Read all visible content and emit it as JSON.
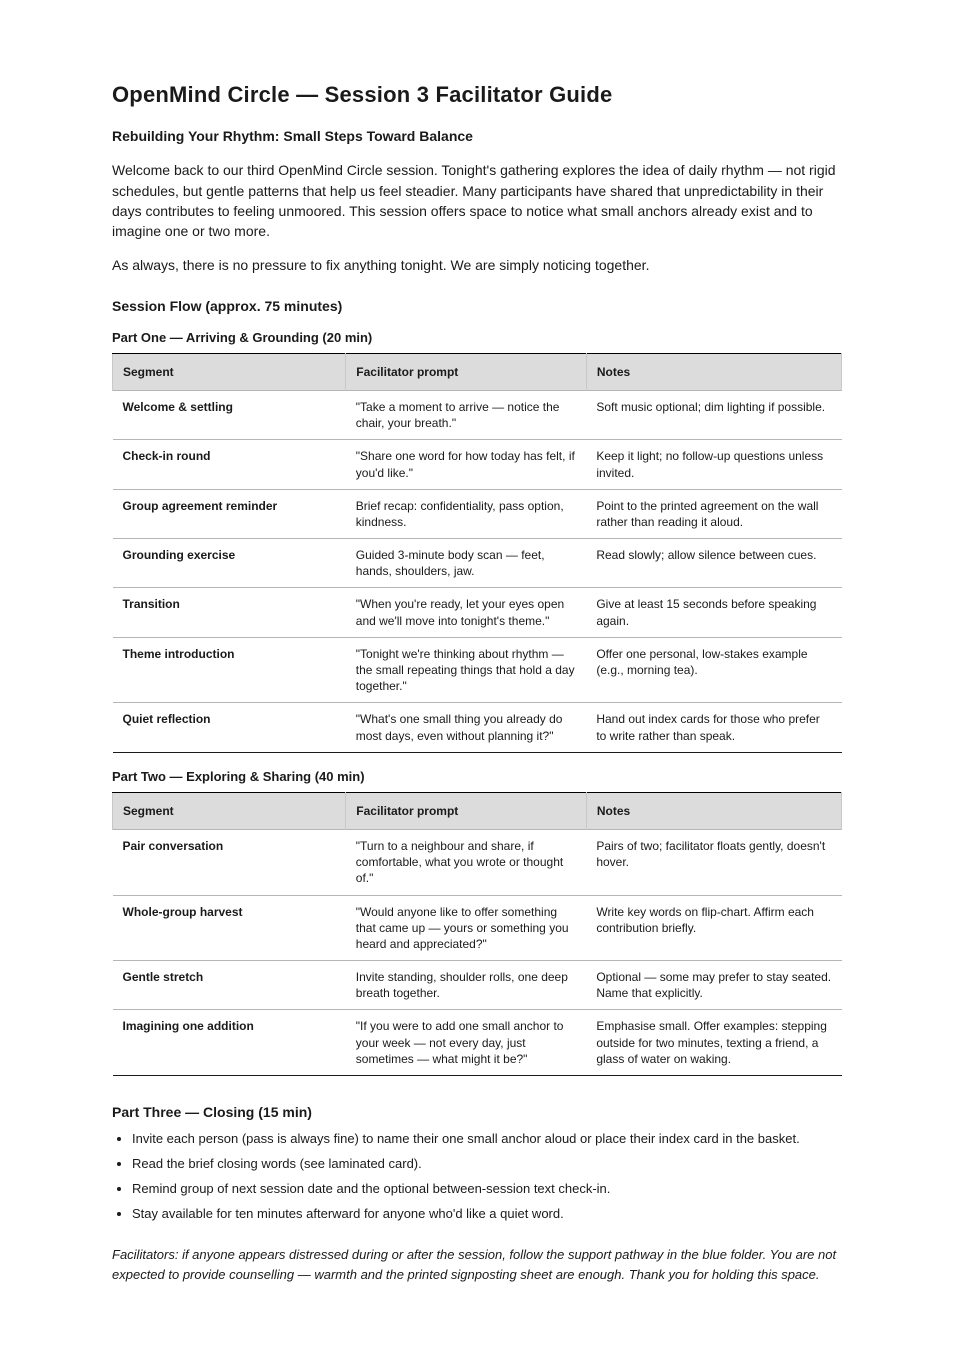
{
  "title": "OpenMind Circle — Session 3 Facilitator Guide",
  "intro": {
    "heading": "Rebuilding Your Rhythm: Small Steps Toward Balance",
    "p1": "Welcome back to our third OpenMind Circle session. Tonight's gathering explores the idea of daily rhythm — not rigid schedules, but gentle patterns that help us feel steadier. Many participants have shared that unpredictability in their days contributes to feeling unmoored. This session offers space to notice what small anchors already exist and to imagine one or two more.",
    "p2": "As always, there is no pressure to fix anything tonight. We are simply noticing together."
  },
  "flow_heading": "Session Flow (approx. 75 minutes)",
  "table1": {
    "title": "Part One — Arriving & Grounding (20 min)",
    "headers": [
      "Segment",
      "Facilitator prompt",
      "Notes"
    ],
    "rows": [
      [
        "Welcome & settling",
        "\"Take a moment to arrive — notice the chair, your breath.\"",
        "Soft music optional; dim lighting if possible."
      ],
      [
        "Check-in round",
        "\"Share one word for how today has felt, if you'd like.\"",
        "Keep it light; no follow-up questions unless invited."
      ],
      [
        "Group agreement reminder",
        "Brief recap: confidentiality, pass option, kindness.",
        "Point to the printed agreement on the wall rather than reading it aloud."
      ],
      [
        "Grounding exercise",
        "Guided 3-minute body scan — feet, hands, shoulders, jaw.",
        "Read slowly; allow silence between cues."
      ],
      [
        "Transition",
        "\"When you're ready, let your eyes open and we'll move into tonight's theme.\"",
        "Give at least 15 seconds before speaking again."
      ],
      [
        "Theme introduction",
        "\"Tonight we're thinking about rhythm — the small repeating things that hold a day together.\"",
        "Offer one personal, low-stakes example (e.g., morning tea)."
      ],
      [
        "Quiet reflection",
        "\"What's one small thing you already do most days, even without planning it?\"",
        "Hand out index cards for those who prefer to write rather than speak."
      ]
    ]
  },
  "table2": {
    "title": "Part Two — Exploring & Sharing (40 min)",
    "headers": [
      "Segment",
      "Facilitator prompt",
      "Notes"
    ],
    "rows": [
      [
        "Pair conversation",
        "\"Turn to a neighbour and share, if comfortable, what you wrote or thought of.\"",
        "Pairs of two; facilitator floats gently, doesn't hover."
      ],
      [
        "Whole-group harvest",
        "\"Would anyone like to offer something that came up — yours or something you heard and appreciated?\"",
        "Write key words on flip-chart. Affirm each contribution briefly."
      ],
      [
        "Gentle stretch",
        "Invite standing, shoulder rolls, one deep breath together.",
        "Optional — some may prefer to stay seated. Name that explicitly."
      ],
      [
        "Imagining one addition",
        "\"If you were to add one small anchor to your week — not every day, just sometimes — what might it be?\"",
        "Emphasise small. Offer examples: stepping outside for two minutes, texting a friend, a glass of water on waking."
      ]
    ]
  },
  "closing": {
    "heading": "Part Three — Closing (15 min)",
    "items": [
      "Invite each person (pass is always fine) to name their one small anchor aloud or place their index card in the basket.",
      "Read the brief closing words (see laminated card).",
      "Remind group of next session date and the optional between-session text check-in.",
      "Stay available for ten minutes afterward for anyone who'd like a quiet word."
    ]
  },
  "footer": "Facilitators: if anyone appears distressed during or after the session, follow the support pathway in the blue folder. You are not expected to provide counselling — warmth and the printed signposting sheet are enough. Thank you for holding this space."
}
